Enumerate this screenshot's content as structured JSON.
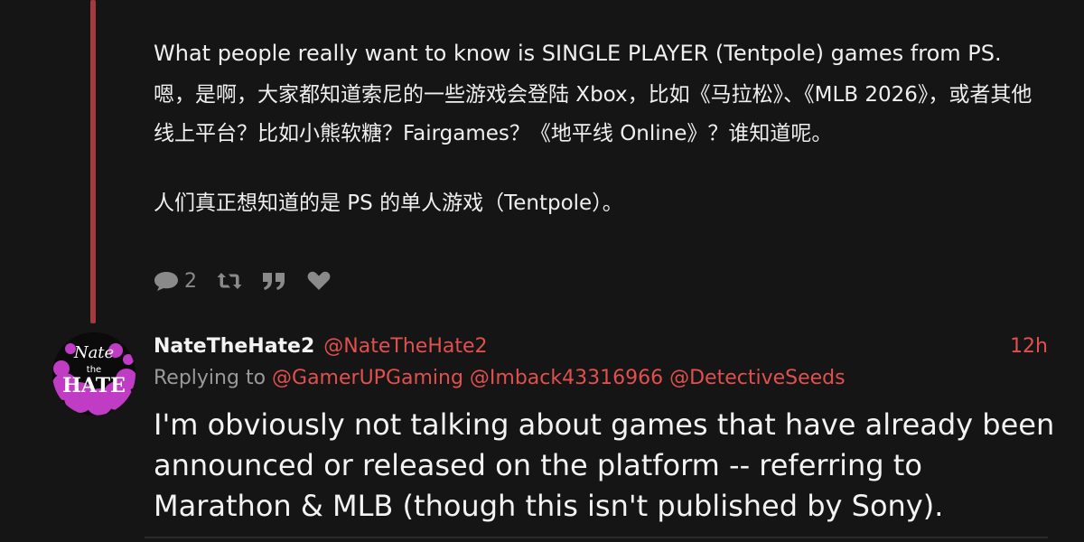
{
  "tweet1": {
    "text_en": "What people really want to know is SINGLE PLAYER (Tentpole) games from PS.",
    "text_cn_1": "嗯，是啊，大家都知道索尼的一些游戏会登陆 Xbox，比如《马拉松》、《MLB 2026》，或者其他线上平台？比如小熊软糖？Fairgames？《地平线 Online》？谁知道呢。",
    "text_cn_2": "人们真正想知道的是 PS 的单人游戏（Tentpole）。",
    "actions": {
      "reply_count": "2"
    }
  },
  "tweet2": {
    "display_name": "NateTheHate2",
    "handle": "@NateTheHate2",
    "time": "12h",
    "replying_label": "Replying to",
    "mentions": [
      "@GamerUPGaming",
      "@Imback43316966",
      "@DetectiveSeeds"
    ],
    "body": "I'm obviously not talking about games that have already been announced or released on the platform -- referring to Marathon & MLB (though this isn't published by Sony).",
    "avatar_text_top": "Nate",
    "avatar_text_mid": "the",
    "avatar_text_bottom": "HATE"
  },
  "colors": {
    "background": "#151515",
    "accent": "#e0504e",
    "thread_line": "#a23a3f",
    "muted": "#8a8a8a",
    "avatar_purple": "#c13cc4"
  },
  "icons": [
    "reply-icon",
    "retweet-icon",
    "quote-icon",
    "like-icon"
  ]
}
